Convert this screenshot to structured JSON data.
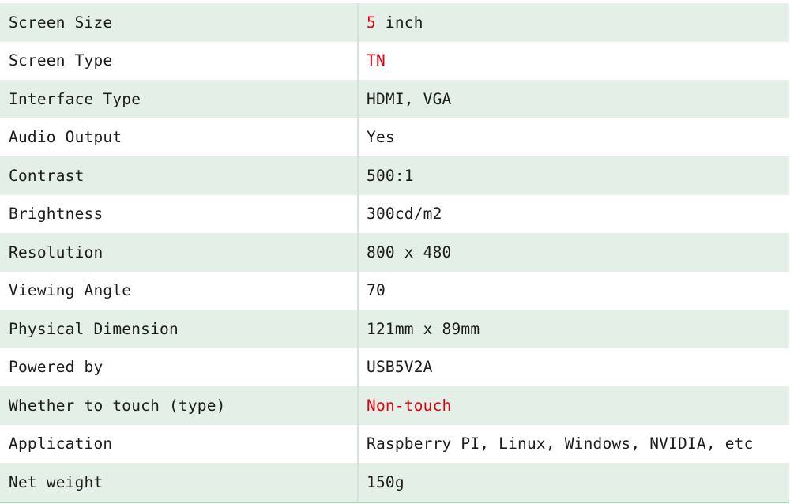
{
  "specs": [
    {
      "label": "Screen Size",
      "value_highlight": "5",
      "value": " inch"
    },
    {
      "label": "Screen Type",
      "value_highlight": "TN",
      "value": ""
    },
    {
      "label": "Interface Type",
      "value": "HDMI, VGA"
    },
    {
      "label": "Audio Output",
      "value": "Yes"
    },
    {
      "label": "Contrast",
      "value": "500:1"
    },
    {
      "label": "Brightness",
      "value": "300cd/m2"
    },
    {
      "label": "Resolution",
      "value": "800 x 480"
    },
    {
      "label": "Viewing Angle",
      "value": "70"
    },
    {
      "label": "Physical Dimension",
      "value": "121mm x 89mm"
    },
    {
      "label": "Powered by",
      "value": "USB5V2A"
    },
    {
      "label": "Whether to touch (type)",
      "value_highlight": "Non-touch",
      "value": ""
    },
    {
      "label": "Application",
      "value": "Raspberry PI, Linux, Windows, NVIDIA, etc"
    },
    {
      "label": "Net weight",
      "value": "150g"
    }
  ],
  "colors": {
    "row_band": "#e3efe7",
    "highlight_text": "#e0000f",
    "bottom_rule": "#a9d3b7"
  }
}
